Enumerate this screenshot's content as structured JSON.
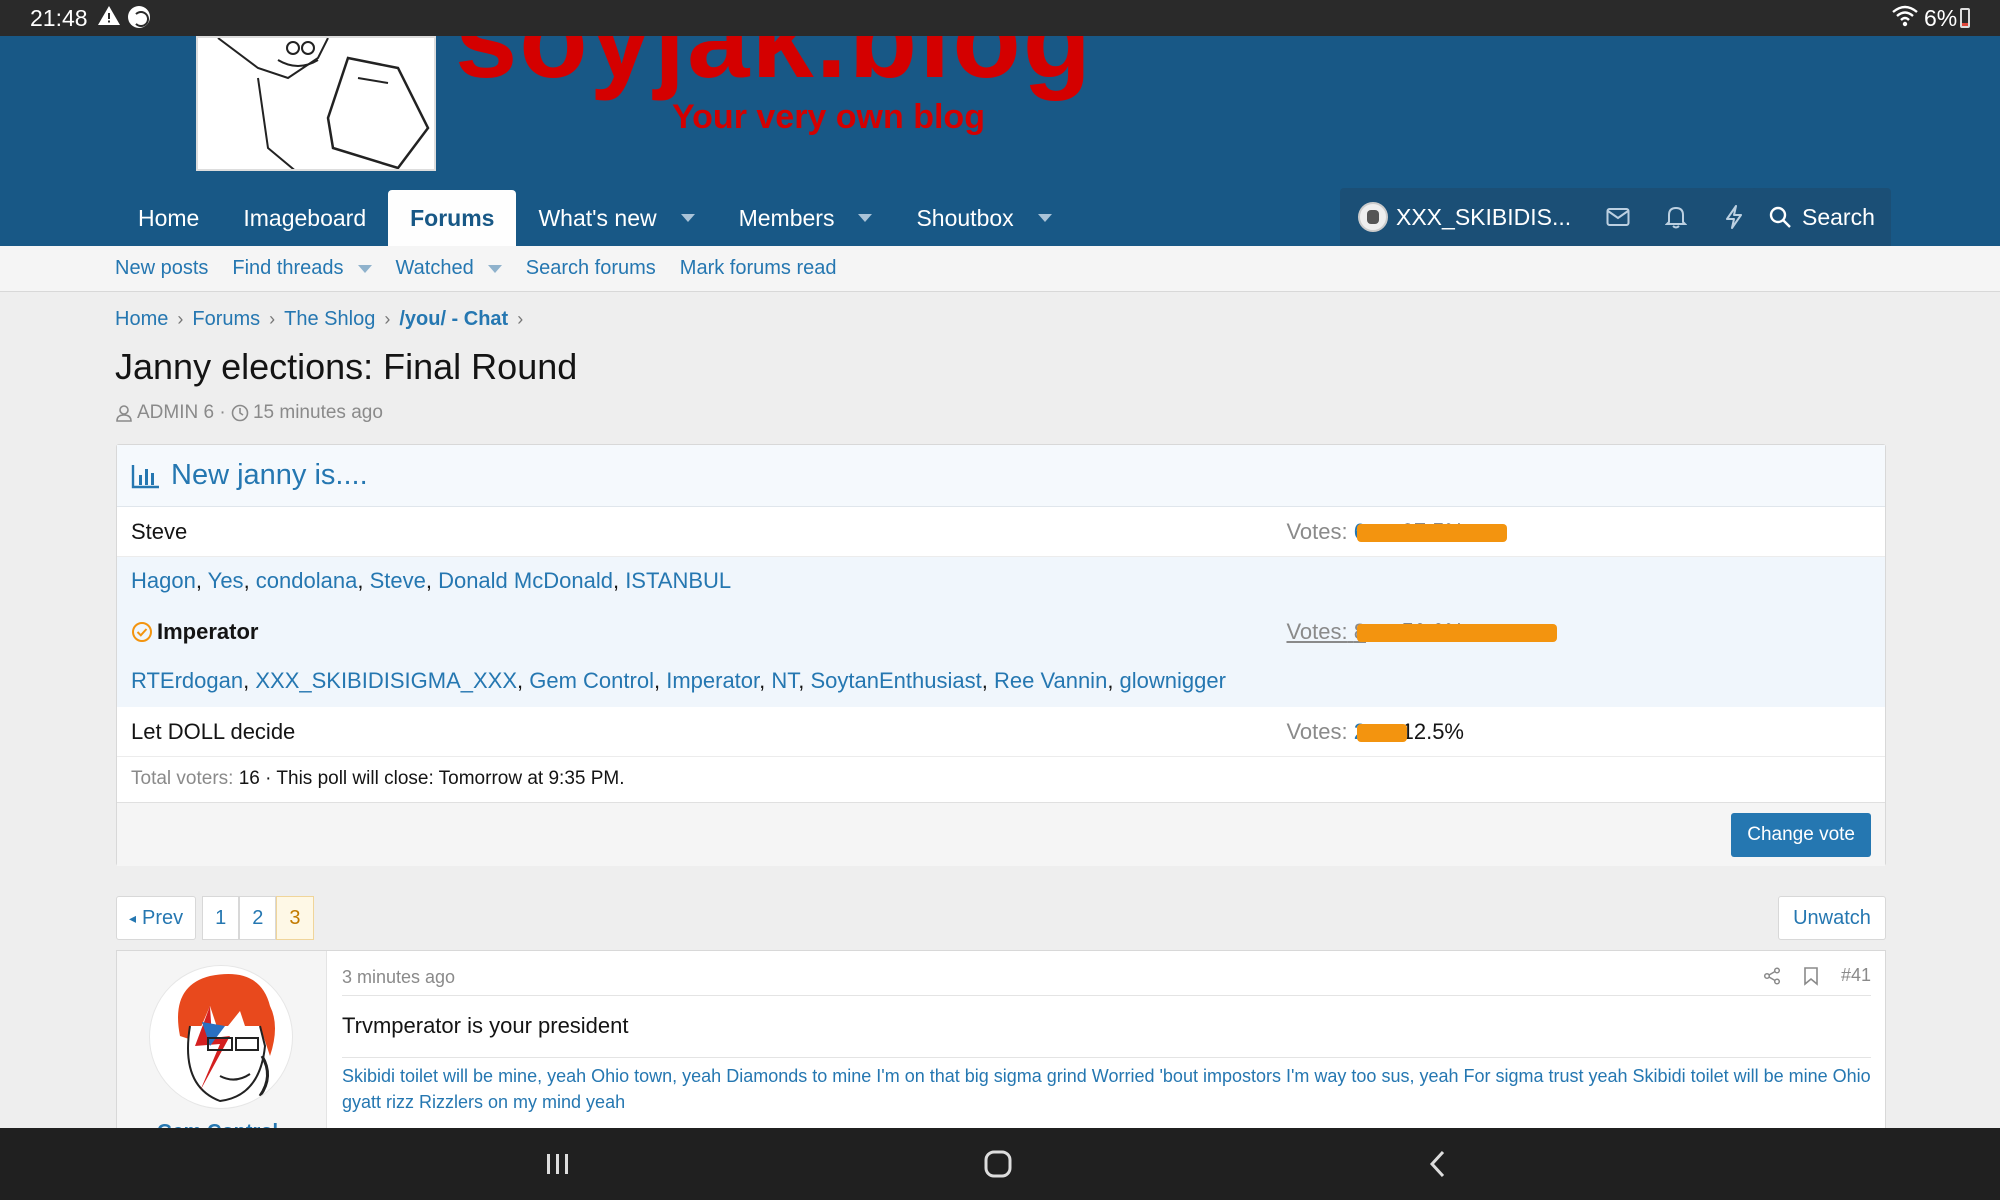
{
  "status_bar": {
    "time": "21:48",
    "battery": "6%"
  },
  "site": {
    "title": "soyjak.blog",
    "tagline": "Your very own blog"
  },
  "nav": {
    "home": "Home",
    "imageboard": "Imageboard",
    "forums": "Forums",
    "whats_new": "What's new",
    "members": "Members",
    "shoutbox": "Shoutbox"
  },
  "user": {
    "name": "XXX_SKIBIDIS..."
  },
  "search_label": "Search",
  "subnav": {
    "new_posts": "New posts",
    "find_threads": "Find threads",
    "watched": "Watched",
    "search_forums": "Search forums",
    "mark_read": "Mark forums read"
  },
  "breadcrumb": [
    "Home",
    "Forums",
    "The Shlog",
    "/you/ - Chat"
  ],
  "thread": {
    "title": "Janny elections: Final Round",
    "author": "ADMIN 6",
    "time": "15 minutes ago"
  },
  "poll": {
    "title": "New janny is....",
    "votes_label": "Votes:",
    "options": [
      {
        "label": "Steve",
        "votes": "6",
        "percent": "37.5%",
        "fraction": 0.375
      },
      {
        "label": "Imperator",
        "votes": "8",
        "percent": "50.0%",
        "fraction": 0.5
      },
      {
        "label": "Let DOLL decide",
        "votes": "2",
        "percent": "12.5%",
        "fraction": 0.125
      }
    ],
    "voters_steve": [
      "Hagon",
      "Yes",
      "condolana",
      "Steve",
      "Donald McDonald",
      "ISTANBUL"
    ],
    "voters_imperator": [
      "RTErdogan",
      "XXX_SKIBIDISIGMA_XXX",
      "Gem Control",
      "Imperator",
      "NT",
      "SoytanEnthusiast",
      "Ree Vannin",
      "glownigger"
    ],
    "total_label": "Total voters:",
    "total": "16",
    "close_text": "· This poll will close: Tomorrow at 9:35 PM.",
    "change_vote": "Change vote"
  },
  "pagination": {
    "prev": "Prev",
    "pages": [
      "1",
      "2",
      "3"
    ],
    "current": "3"
  },
  "unwatch": "Unwatch",
  "post": {
    "username": "Gem Control",
    "time": "3 minutes ago",
    "number": "#41",
    "body": "Trvmperator is your president",
    "signature": "Skibidi toilet will be mine, yeah Ohio town, yeah Diamonds to mine I'm on that big sigma grind Worried 'bout impostors I'm way too sus, yeah For sigma trust yeah Skibidi toilet will be mine Ohio gyatt rizz Rizzlers on my mind yeah"
  },
  "colors": {
    "header": "#185886",
    "link": "#2577b1",
    "bar": "#f3940f",
    "brand_red": "#d40000"
  }
}
